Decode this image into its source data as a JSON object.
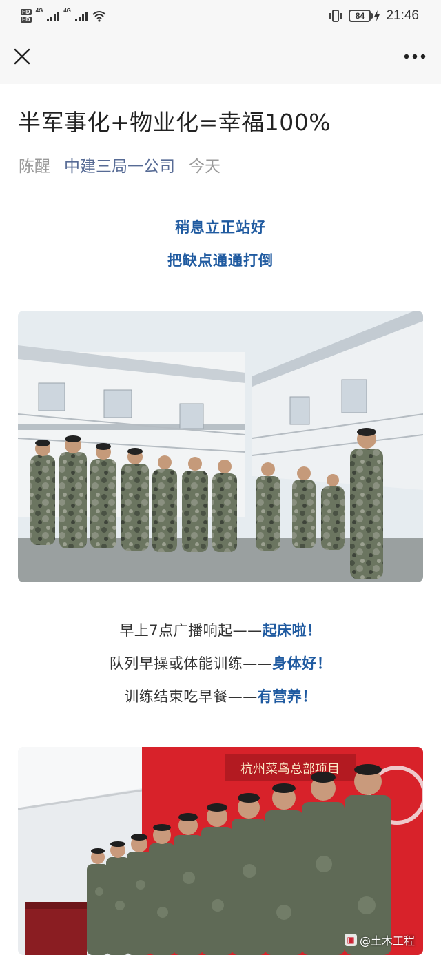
{
  "status_bar": {
    "hd_badge_1": "HD",
    "hd_badge_2": "HD",
    "network_1": "4G",
    "network_2": "4G",
    "battery_level": "84",
    "time": "21:46"
  },
  "nav": {
    "close_icon": "close-icon",
    "more_icon": "more-icon"
  },
  "article": {
    "title": "半军事化+物业化=幸福100%",
    "author": "陈醒",
    "account": "中建三局一公司",
    "date": "今天",
    "intro_line_1": "稍息立正站好",
    "intro_line_2": "把缺点通通打倒",
    "schedule": [
      {
        "text": "早上7点广播响起——",
        "highlight": "起床啦！"
      },
      {
        "text": "队列早操或体能训练——",
        "highlight": "身体好！"
      },
      {
        "text": "训练结束吃早餐——",
        "highlight": "有营养！"
      }
    ],
    "photo_1_sign": "",
    "photo_2_sign": "杭州菜鸟总部项目",
    "watermark": "@土木工程",
    "highlight_color": "#1f5aa0"
  }
}
